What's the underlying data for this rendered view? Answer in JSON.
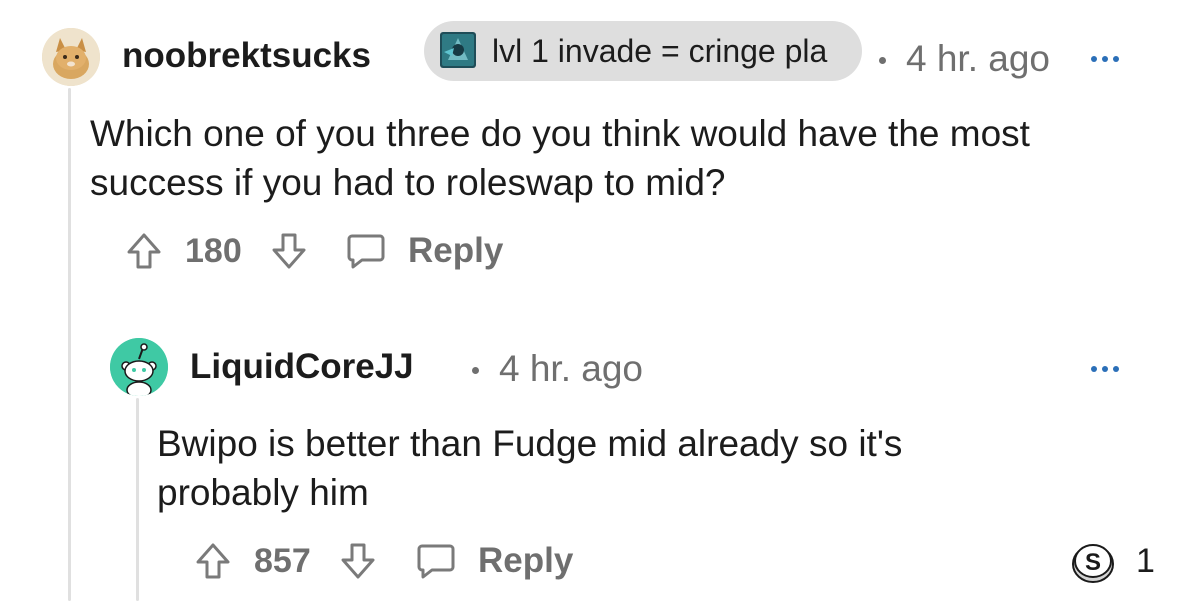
{
  "comment": {
    "username": "noobrektsucks",
    "flair": "lvl 1 invade = cringe pla",
    "time": "4 hr. ago",
    "body": "Which one of you three do you think would have the most success if you had to roleswap to mid?",
    "upvotes": "180",
    "reply_label": "Reply"
  },
  "reply": {
    "username": "LiquidCoreJJ",
    "time": "4 hr. ago",
    "body": "Bwipo is better than Fudge mid already so it's probably him",
    "upvotes": "857",
    "reply_label": "Reply",
    "award_count": "1"
  },
  "colors": {
    "meta": "#6f6f6f",
    "more_dots": "#2b6fb8",
    "flair_bg": "#dedede",
    "snoo_green": "#3fc9a4"
  }
}
